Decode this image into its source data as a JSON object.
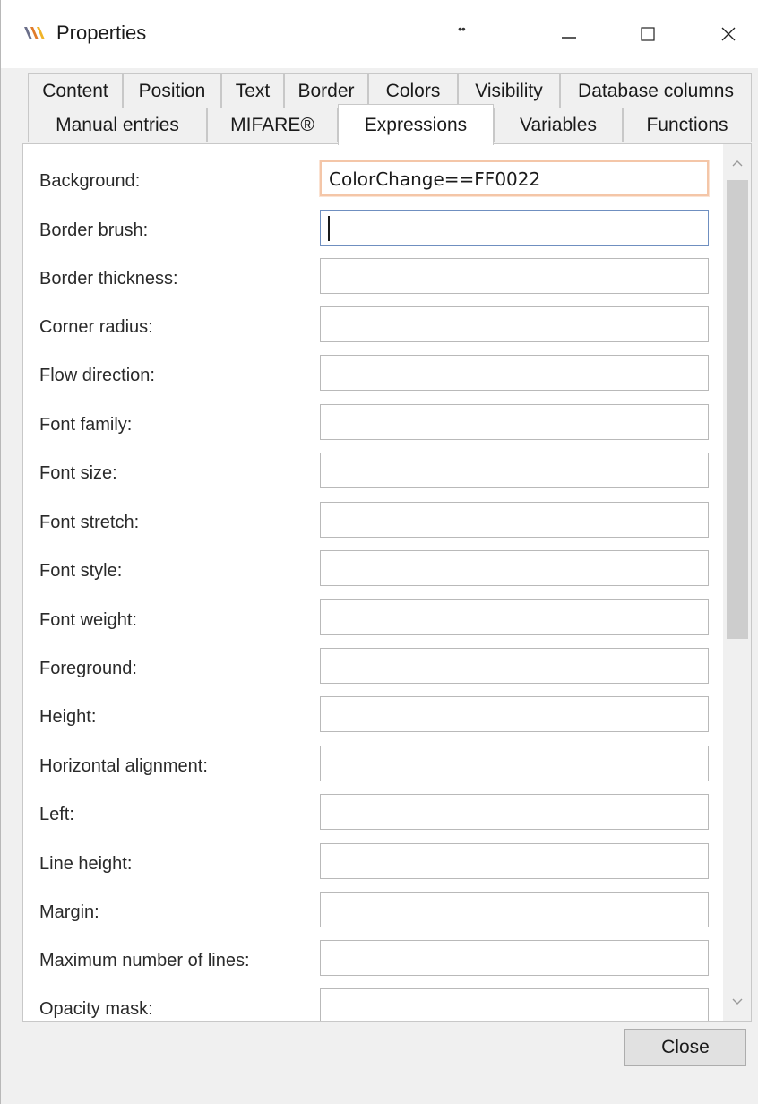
{
  "window": {
    "title": "Properties",
    "grip_glyph": "••",
    "app_icon": "app-logo-icon",
    "controls": {
      "minimize_icon": "minimize-icon",
      "maximize_icon": "maximize-icon",
      "close_icon": "close-icon"
    }
  },
  "tabs": {
    "row1": [
      {
        "label": "Content"
      },
      {
        "label": "Position"
      },
      {
        "label": "Text"
      },
      {
        "label": "Border"
      },
      {
        "label": "Colors"
      },
      {
        "label": "Visibility"
      },
      {
        "label": "Database columns"
      }
    ],
    "row2": [
      {
        "label": "Manual entries"
      },
      {
        "label": "MIFARE®"
      },
      {
        "label": "Expressions",
        "active": true
      },
      {
        "label": "Variables"
      },
      {
        "label": "Functions"
      }
    ]
  },
  "fields": [
    {
      "label": "Background:",
      "value": "ColorChange==FF0022"
    },
    {
      "label": "Border brush:",
      "value": ""
    },
    {
      "label": "Border thickness:",
      "value": ""
    },
    {
      "label": "Corner radius:",
      "value": ""
    },
    {
      "label": "Flow direction:",
      "value": ""
    },
    {
      "label": "Font family:",
      "value": ""
    },
    {
      "label": "Font size:",
      "value": ""
    },
    {
      "label": "Font stretch:",
      "value": ""
    },
    {
      "label": "Font style:",
      "value": ""
    },
    {
      "label": "Font weight:",
      "value": ""
    },
    {
      "label": "Foreground:",
      "value": ""
    },
    {
      "label": "Height:",
      "value": ""
    },
    {
      "label": "Horizontal alignment:",
      "value": ""
    },
    {
      "label": "Left:",
      "value": ""
    },
    {
      "label": "Line height:",
      "value": ""
    },
    {
      "label": "Margin:",
      "value": ""
    },
    {
      "label": "Maximum number of lines:",
      "value": ""
    },
    {
      "label": "Opacity mask:",
      "value": ""
    }
  ],
  "scrollbar": {
    "up_icon": "chevron-up-icon",
    "down_icon": "chevron-down-icon"
  },
  "footer": {
    "close_label": "Close"
  },
  "colors": {
    "focus_highlight": "#f4c6a8",
    "active_tab": "#ffffff",
    "window_bg": "#f0f0f0"
  }
}
